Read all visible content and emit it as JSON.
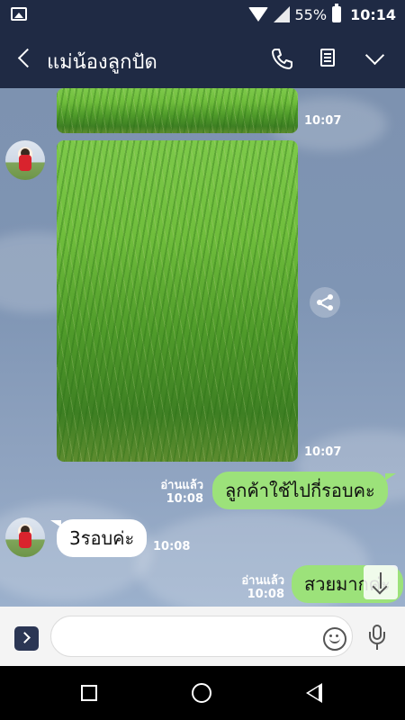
{
  "status_bar": {
    "battery_percent": "55%",
    "time": "10:14",
    "icons": [
      "image-notification-icon",
      "wifi-icon",
      "signal-icon",
      "battery-icon"
    ]
  },
  "header": {
    "title": "แม่น้องลูกปัด",
    "icons": [
      "back-icon",
      "phone-icon",
      "notes-icon",
      "chevron-down-icon"
    ]
  },
  "messages": [
    {
      "type": "image",
      "direction": "incoming",
      "time": "10:07"
    },
    {
      "type": "image",
      "direction": "incoming",
      "time": "10:07"
    },
    {
      "type": "text",
      "direction": "outgoing",
      "text": "ลูกค้าใช้ไปกี่รอบคะ",
      "read_label": "อ่านแล้ว",
      "time": "10:08"
    },
    {
      "type": "text",
      "direction": "incoming",
      "text": "3รอบค่ะ",
      "time": "10:08"
    },
    {
      "type": "text",
      "direction": "outgoing",
      "text": "สวยมากค่ะ",
      "read_label": "อ่านแล้ว",
      "time": "10:08"
    }
  ],
  "input": {
    "placeholder": "",
    "value": ""
  },
  "colors": {
    "header_bg": "#1f2a44",
    "bubble_out": "#9ce27a",
    "bubble_in": "#ffffff",
    "chat_bg": "#7f95b4"
  }
}
